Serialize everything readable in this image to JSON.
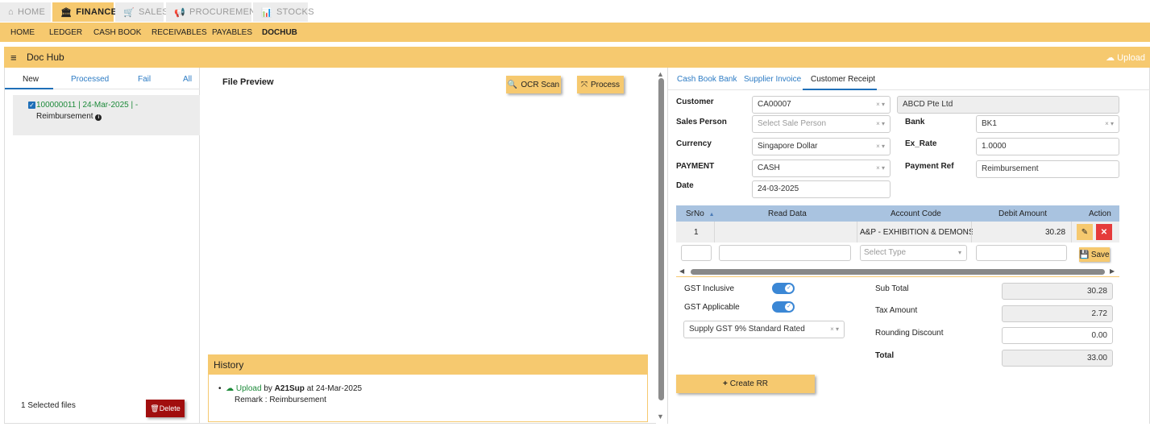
{
  "top_tabs": [
    {
      "icon": "⌂",
      "label": "HOME"
    },
    {
      "icon": "🏛",
      "label": "FINANCE"
    },
    {
      "icon": "🛒",
      "label": "SALES"
    },
    {
      "icon": "📢",
      "label": "PROCUREMENT"
    },
    {
      "icon": "📊",
      "label": "STOCKS"
    }
  ],
  "subnav": [
    "HOME",
    "LEDGER",
    "CASH BOOK",
    "RECEIVABLES",
    "PAYABLES",
    "DOCHUB"
  ],
  "dochub": {
    "title": "Doc Hub",
    "menu_icon": "≡",
    "upload_label": "Upload"
  },
  "left": {
    "tabs": [
      "New",
      "Processed",
      "Fail",
      "All"
    ],
    "file_id": "100000011 | 24-Mar-2025 | -",
    "file_desc": "Reimbursement",
    "selected_text": "1 Selected files",
    "delete_label": "Delete"
  },
  "middle": {
    "preview_title": "File Preview",
    "ocr_label": "OCR Scan",
    "process_label": "Process",
    "history_title": "History",
    "history_action": "Upload",
    "history_by": "by",
    "history_user": "A21Sup",
    "history_at": "at",
    "history_date": "24-Mar-2025",
    "history_remark": "Remark : Reimbursement"
  },
  "right": {
    "tabs": [
      "Cash Book Bank",
      "Supplier Invoice",
      "Customer Receipt"
    ],
    "customer_label": "Customer",
    "customer_value": "CA00007",
    "customer_name": "ABCD Pte Ltd",
    "sales_person_label": "Sales Person",
    "sales_person_placeholder": "Select Sale Person",
    "bank_label": "Bank",
    "bank_value": "BK1",
    "currency_label": "Currency",
    "currency_value": "Singapore Dollar",
    "ex_rate_label": "Ex_Rate",
    "ex_rate_value": "1.0000",
    "payment_label": "PAYMENT",
    "payment_value": "CASH",
    "payment_ref_label": "Payment Ref",
    "payment_ref_value": "Reimbursement",
    "date_label": "Date",
    "date_value": "24-03-2025",
    "clear_icon": "× ▾",
    "table": {
      "headers": [
        "SrNo",
        "Read Data",
        "Account Code",
        "Debit Amount",
        "Action"
      ],
      "sort_icon": "▲",
      "row": {
        "srno": "1",
        "read_data": "",
        "account_code": "A&P - EXHIBITION & DEMONST...",
        "debit_amount": "30.28"
      },
      "select_type_placeholder": "Select Type",
      "save_label": "Save"
    },
    "gst_inclusive_label": "GST Inclusive",
    "gst_applicable_label": "GST Applicable",
    "gst_type_value": "Supply GST 9% Standard Rated",
    "sub_total_label": "Sub Total",
    "sub_total_value": "30.28",
    "tax_amount_label": "Tax Amount",
    "tax_amount_value": "2.72",
    "rounding_label": "Rounding Discount",
    "rounding_value": "0.00",
    "total_label": "Total",
    "total_value": "33.00",
    "create_label": "Create RR"
  }
}
